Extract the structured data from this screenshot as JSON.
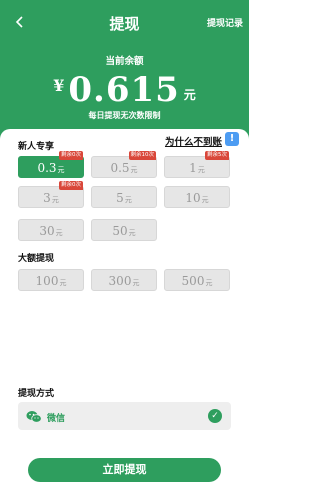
{
  "header": {
    "title": "提现",
    "record_label": "提现记录"
  },
  "balance": {
    "label": "当前余额",
    "currency_symbol": "¥",
    "amount": "0.615",
    "unit": "元",
    "limit_note": "每日提现无次数限制"
  },
  "sections": {
    "newcomer_title": "新人专享",
    "large_title": "大额提现",
    "method_title": "提现方式",
    "why_label": "为什么不到账",
    "info_icon_text": "!"
  },
  "options": [
    {
      "value": "0.3",
      "unit": "元",
      "tag": "剩余0次",
      "selected": true
    },
    {
      "value": "0.5",
      "unit": "元",
      "tag": "剩余10次",
      "selected": false
    },
    {
      "value": "1",
      "unit": "元",
      "tag": "剩余5次",
      "selected": false
    },
    {
      "value": "3",
      "unit": "元",
      "tag": "剩余0次",
      "selected": false
    },
    {
      "value": "5",
      "unit": "元",
      "tag": "",
      "selected": false
    },
    {
      "value": "10",
      "unit": "元",
      "tag": "",
      "selected": false
    },
    {
      "value": "30",
      "unit": "元",
      "tag": "",
      "selected": false
    },
    {
      "value": "50",
      "unit": "元",
      "tag": "",
      "selected": false
    }
  ],
  "large_options": [
    {
      "value": "100",
      "unit": "元"
    },
    {
      "value": "300",
      "unit": "元"
    },
    {
      "value": "500",
      "unit": "元"
    }
  ],
  "payment": {
    "method_label": "微信",
    "icon": "wechat-icon",
    "selected": true
  },
  "submit_label": "立即提现",
  "colors": {
    "brand_green": "#2e9e5e",
    "tag_red": "#d9473a",
    "info_blue": "#4d9cf2"
  }
}
